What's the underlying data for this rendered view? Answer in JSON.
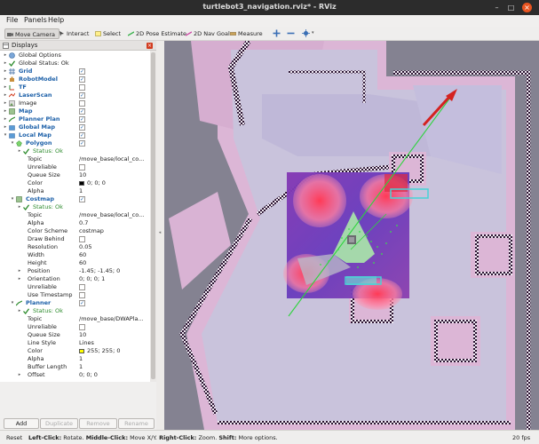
{
  "window": {
    "title": "turtlebot3_navigation.rviz* - RViz"
  },
  "menu": {
    "file": "File",
    "panels": "Panels",
    "help": "Help"
  },
  "toolbar": {
    "move_camera": "Move Camera",
    "interact": "Interact",
    "select": "Select",
    "pose_estimate": "2D Pose Estimate",
    "nav_goal": "2D Nav Goal",
    "measure": "Measure"
  },
  "displays_panel": {
    "title": "Displays",
    "rows": [
      {
        "label": "Global Options"
      },
      {
        "label": "Global Status: Ok"
      },
      {
        "label": "Grid",
        "checked": true
      },
      {
        "label": "RobotModel",
        "checked": true
      },
      {
        "label": "TF",
        "checked": false
      },
      {
        "label": "LaserScan",
        "checked": true
      },
      {
        "label": "Image",
        "checked": false
      },
      {
        "label": "Map",
        "checked": true
      },
      {
        "label": "Planner Plan",
        "checked": true
      },
      {
        "label": "Global Map",
        "checked": true
      },
      {
        "label": "Local Map",
        "checked": true
      },
      {
        "label": "Polygon",
        "checked": true
      },
      {
        "label": "Status: Ok"
      },
      {
        "label": "Topic",
        "value": "/move_base/local_co..."
      },
      {
        "label": "Unreliable",
        "checked": false
      },
      {
        "label": "Queue Size",
        "value": "10"
      },
      {
        "label": "Color",
        "value": "0; 0; 0",
        "swatch": "#000000"
      },
      {
        "label": "Alpha",
        "value": "1"
      },
      {
        "label": "Costmap",
        "checked": true
      },
      {
        "label": "Status: Ok"
      },
      {
        "label": "Topic",
        "value": "/move_base/local_co..."
      },
      {
        "label": "Alpha",
        "value": "0.7"
      },
      {
        "label": "Color Scheme",
        "value": "costmap"
      },
      {
        "label": "Draw Behind",
        "checked": false
      },
      {
        "label": "Resolution",
        "value": "0.05"
      },
      {
        "label": "Width",
        "value": "60"
      },
      {
        "label": "Height",
        "value": "60"
      },
      {
        "label": "Position",
        "value": "-1.45; -1.45; 0"
      },
      {
        "label": "Orientation",
        "value": "0; 0; 0; 1"
      },
      {
        "label": "Unreliable",
        "checked": false
      },
      {
        "label": "Use Timestamp",
        "checked": false
      },
      {
        "label": "Planner",
        "checked": true
      },
      {
        "label": "Status: Ok"
      },
      {
        "label": "Topic",
        "value": "/move_base/DWAPla..."
      },
      {
        "label": "Unreliable",
        "checked": false
      },
      {
        "label": "Queue Size",
        "value": "10"
      },
      {
        "label": "Line Style",
        "value": "Lines"
      },
      {
        "label": "Color",
        "value": "255; 255; 0",
        "swatch": "#ffff00"
      },
      {
        "label": "Alpha",
        "value": "1"
      },
      {
        "label": "Buffer Length",
        "value": "1"
      },
      {
        "label": "Offset",
        "value": "0; 0; 0"
      }
    ],
    "buttons": {
      "add": "Add",
      "duplicate": "Duplicate",
      "remove": "Remove",
      "rename": "Rename"
    }
  },
  "status_bar": {
    "reset": "Reset",
    "left_click_key": "Left-Click:",
    "left_click_text": "Rotate.",
    "middle_click_key": "Middle-Click:",
    "middle_click_text": "Move X/Y.",
    "right_click_key": "Right-Click:",
    "right_click_text": "Zoom.",
    "shift_key": "Shift:",
    "shift_text": "More options.",
    "fps": "20 fps"
  },
  "colors": {
    "accent": "#e95420",
    "display_name_blue": "#1b5fa8",
    "status_green": "#2b8a2b"
  }
}
